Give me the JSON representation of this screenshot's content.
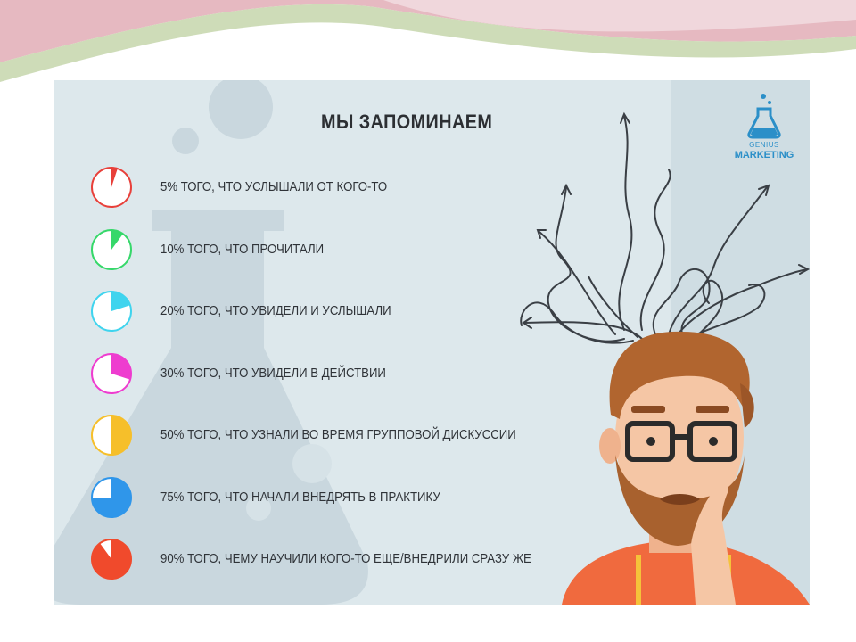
{
  "title": "МЫ ЗАПОМИНАЕМ",
  "logo": {
    "line1": "GENIUS",
    "line2": "MARKETING"
  },
  "items": [
    {
      "percent": 5,
      "label": "5% ТОГО, ЧТО УСЛЫШАЛИ ОТ КОГО-ТО",
      "color": "#e8403a"
    },
    {
      "percent": 10,
      "label": "10% ТОГО, ЧТО ПРОЧИТАЛИ",
      "color": "#36d86a"
    },
    {
      "percent": 20,
      "label": "20% ТОГО, ЧТО УВИДЕЛИ И УСЛЫШАЛИ",
      "color": "#3fd4ee"
    },
    {
      "percent": 30,
      "label": "30% ТОГО, ЧТО УВИДЕЛИ В ДЕЙСТВИИ",
      "color": "#ee3ccf"
    },
    {
      "percent": 50,
      "label": "50% ТОГО, ЧТО УЗНАЛИ ВО ВРЕМЯ ГРУППОВОЙ ДИСКУССИИ",
      "color": "#f6bf2a"
    },
    {
      "percent": 75,
      "label": "75% ТОГО, ЧТО НАЧАЛИ ВНЕДРЯТЬ В ПРАКТИКУ",
      "color": "#2f96ea"
    },
    {
      "percent": 90,
      "label": "90% ТОГО, ЧЕМУ НАУЧИЛИ КОГО-ТО ЕЩЕ/ВНЕДРИЛИ СРАЗУ ЖЕ",
      "color": "#f04a2c"
    }
  ]
}
